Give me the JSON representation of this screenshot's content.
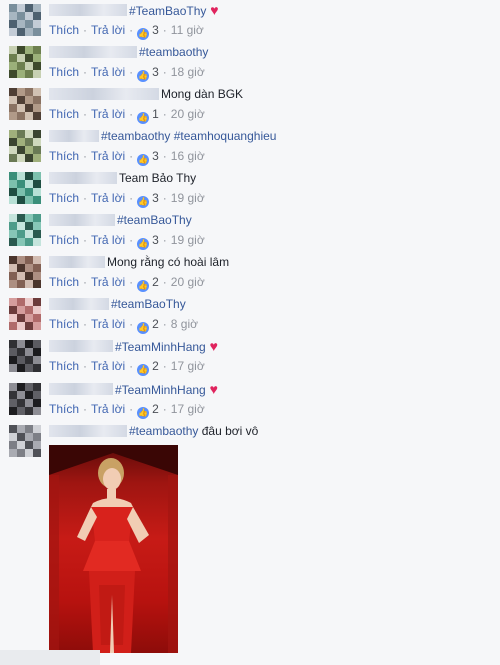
{
  "actions": {
    "like": "Thích",
    "reply": "Trả lời"
  },
  "colors": {
    "hashtag": "#365899",
    "like_badge": "#5890ff",
    "heart": "#e0245e"
  },
  "comments": [
    {
      "hashtag": "#TeamBaoThy",
      "text": "",
      "heart": true,
      "likes": "3",
      "time": "11 giờ"
    },
    {
      "hashtag": "#teambaothy",
      "text": "",
      "heart": false,
      "likes": "3",
      "time": "18 giờ"
    },
    {
      "hashtag": "",
      "text": "Mong dàn BGK",
      "heart": false,
      "likes": "1",
      "time": "20 giờ"
    },
    {
      "hashtag": "#teambaothy #teamhoquanghieu",
      "text": "",
      "heart": false,
      "likes": "3",
      "time": "16 giờ"
    },
    {
      "hashtag": "",
      "text": "Team Bảo Thy",
      "heart": false,
      "likes": "3",
      "time": "19 giờ"
    },
    {
      "hashtag": "#teamBaoThy",
      "text": "",
      "heart": false,
      "likes": "3",
      "time": "19 giờ"
    },
    {
      "hashtag": "",
      "text": "Mong rằng có hoài lâm",
      "heart": false,
      "likes": "2",
      "time": "20 giờ"
    },
    {
      "hashtag": "#teamBaoThy",
      "text": "",
      "heart": false,
      "likes": "2",
      "time": "8 giờ"
    },
    {
      "hashtag": "#TeamMinhHang",
      "text": "",
      "heart": true,
      "likes": "2",
      "time": "17 giờ"
    },
    {
      "hashtag": "#TeamMinhHang",
      "text": "",
      "heart": true,
      "likes": "2",
      "time": "17 giờ"
    },
    {
      "hashtag": "#teambaothy",
      "text": "đâu bơi vô",
      "heart": false,
      "likes": "",
      "time": ""
    }
  ],
  "heart_glyph": "♥",
  "like_glyph": "👍",
  "separator": "·",
  "photo_alt_icon": "photo-attachment"
}
